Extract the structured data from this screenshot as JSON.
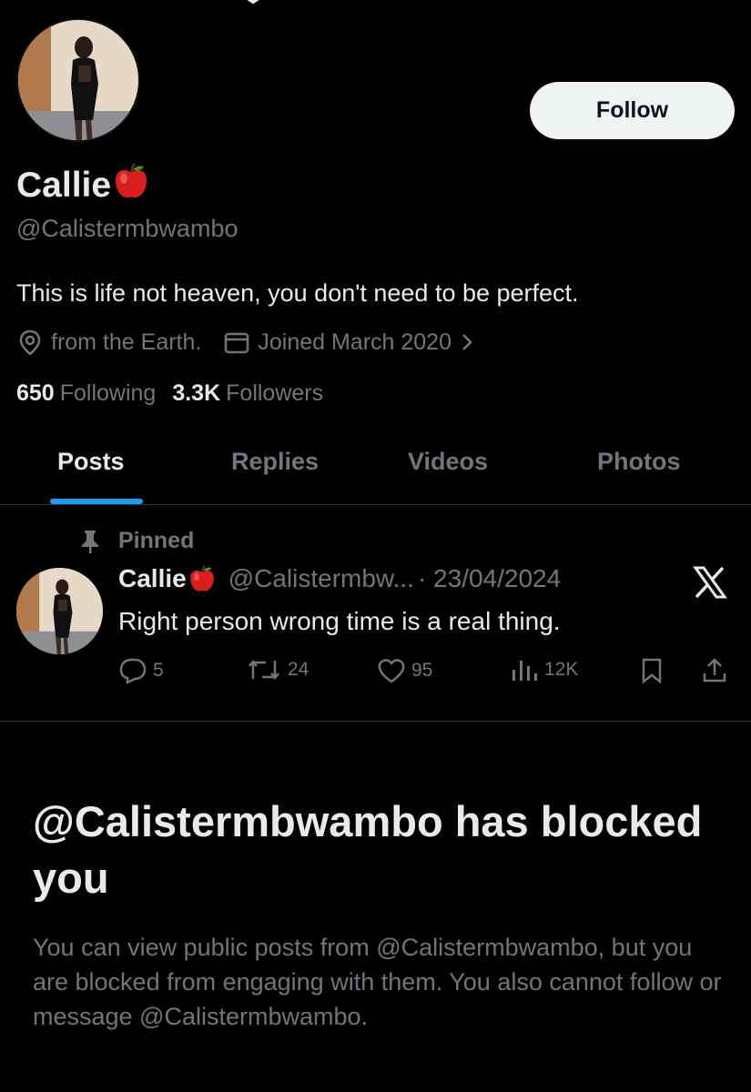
{
  "profile": {
    "display_name": "Callie",
    "handle": "@Calistermbwambo",
    "bio": "This is life not heaven, you don't need to be perfect.",
    "location": "from the Earth.",
    "joined": "Joined March 2020",
    "following_count": "650",
    "following_label": "Following",
    "followers_count": "3.3K",
    "followers_label": "Followers",
    "follow_label": "Follow"
  },
  "tabs": [
    {
      "label": "Posts",
      "active": true
    },
    {
      "label": "Replies",
      "active": false
    },
    {
      "label": "Videos",
      "active": false
    },
    {
      "label": "Photos",
      "active": false
    }
  ],
  "pinned_post": {
    "pinned_label": "Pinned",
    "author_name": "Callie",
    "author_handle": "@Calistermbw...",
    "date": "· 23/04/2024",
    "text": "Right person wrong time is a real thing.",
    "replies": "5",
    "reposts": "24",
    "likes": "95",
    "views": "12K"
  },
  "blocked": {
    "title": "@Calistermbwambo has blocked you",
    "description": "You can view public posts from @Calistermbwambo, but you are blocked from engaging with them. You also cannot follow or message @Calistermbwambo."
  },
  "colors": {
    "background": "#000000",
    "text_primary": "#e7e9ea",
    "text_secondary": "#71767b",
    "accent": "#1d9bf0",
    "button_bg": "#eff3f4"
  }
}
